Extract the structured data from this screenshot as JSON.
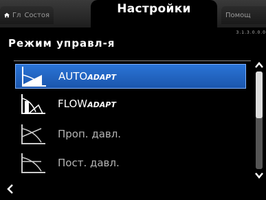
{
  "tabs": {
    "home_label": "Гл",
    "status_label": "Состоя",
    "active_label": "Настройки",
    "help_label": "Помощ"
  },
  "breadcrumb_id": "3.1.3.0.0.0",
  "page_title": "Режим управл-я",
  "items": [
    {
      "name_main": "AUTO",
      "name_suffix": "ADAPT",
      "selected": true
    },
    {
      "name_main": "FLOW",
      "name_suffix": "ADAPT",
      "selected": false
    },
    {
      "name_main": "Проп. давл.",
      "name_suffix": "",
      "selected": false
    },
    {
      "name_main": "Пост. давл.",
      "name_suffix": "",
      "selected": false
    }
  ],
  "colors": {
    "selection": "#1f63c4",
    "background": "#000000"
  }
}
